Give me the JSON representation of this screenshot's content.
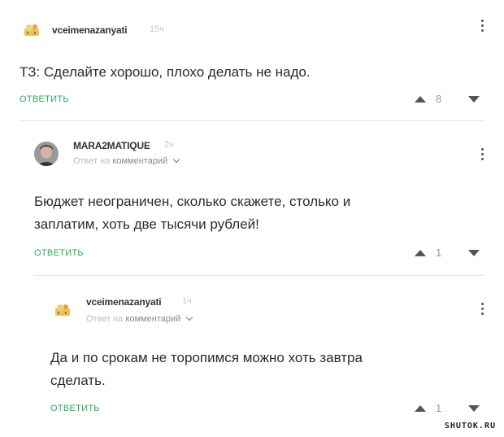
{
  "comments": [
    {
      "username": "vceimenazanyati",
      "time": "15ч",
      "text_lines": [
        "ТЗ: Сделайте хорошо, плохо делать не надо."
      ],
      "reply_label": "ОТВЕТИТЬ",
      "votes": "8"
    },
    {
      "username": "MARA2MATIQUE",
      "time": "2ч",
      "reply_to_prefix": "Ответ на",
      "reply_to_target": "комментарий",
      "text_lines": [
        "Бюджет неограничен, сколько скажете, столько и",
        "заплатим, хоть две тысячи рублей!"
      ],
      "reply_label": "ОТВЕТИТЬ",
      "votes": "1"
    },
    {
      "username": "vceimenazanyati",
      "time": "1ч",
      "reply_to_prefix": "Ответ на",
      "reply_to_target": "комментарий",
      "text_lines": [
        "Да и по срокам не торопимся можно хоть завтра",
        "сделать."
      ],
      "reply_label": "ОТВЕТИТЬ",
      "votes": "1"
    }
  ],
  "watermark": "SHUTOK.RU",
  "colors": {
    "reply_green": "#2aaa5a",
    "text": "#2b2b2b",
    "muted": "#bdbdbd"
  },
  "icons": {
    "avatar_1": "cartoon-avatar-icon",
    "avatar_2": "person-photo-avatar",
    "menu": "vertical-dots-icon",
    "upvote": "triangle-up-icon",
    "downvote": "triangle-down-icon"
  }
}
